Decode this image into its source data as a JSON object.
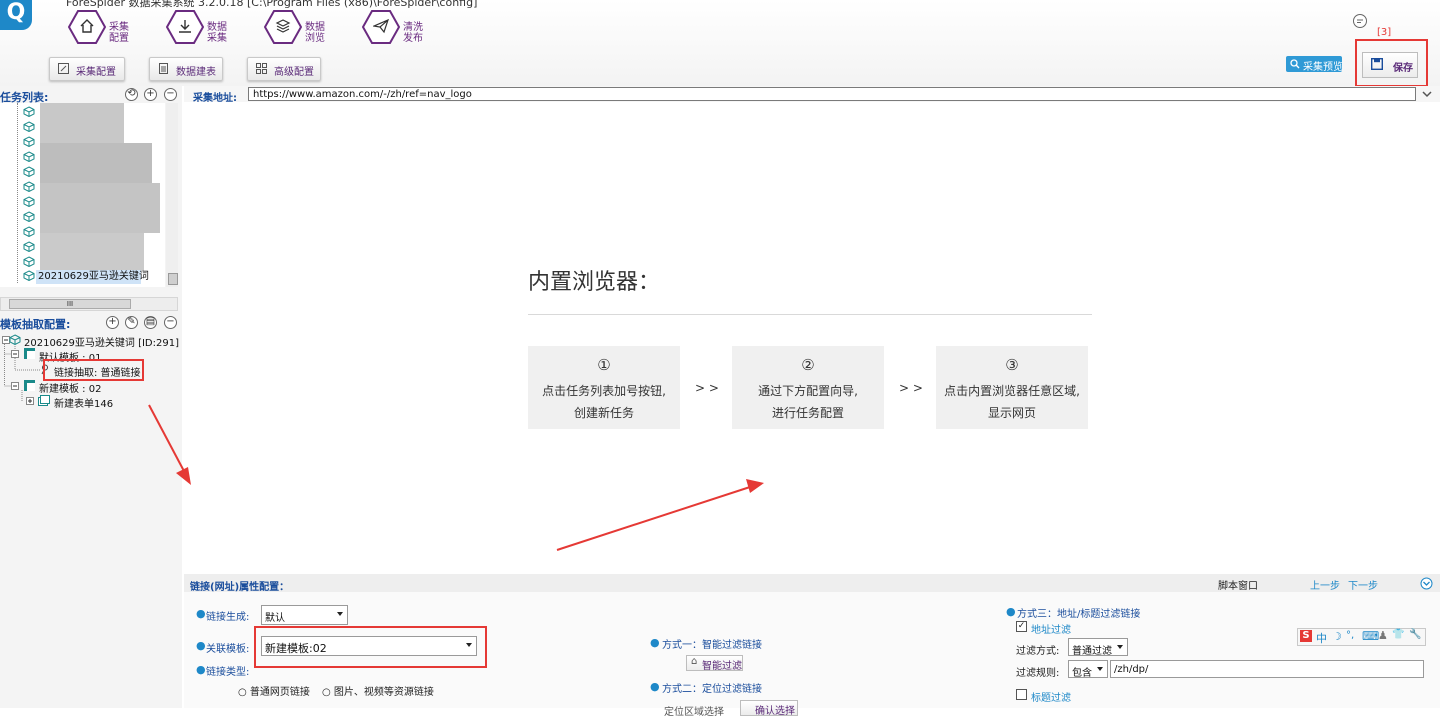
{
  "app": {
    "title": "ForeSpider 数据采集系统 3.2.0.18 [C:\\Program Files (x86)\\ForeSpider\\config]",
    "logo_text": "Q",
    "annotation": "[3]"
  },
  "nav": [
    {
      "label_top": "采集",
      "label_bottom": "配置",
      "icon": "home-icon"
    },
    {
      "label_top": "数据",
      "label_bottom": "采集",
      "icon": "download-icon"
    },
    {
      "label_top": "数据",
      "label_bottom": "浏览",
      "icon": "layers-icon"
    },
    {
      "label_top": "清洗",
      "label_bottom": "发布",
      "icon": "send-icon"
    }
  ],
  "tabs": [
    {
      "label": "采集配置",
      "icon": "edit-icon"
    },
    {
      "label": "数据建表",
      "icon": "document-icon"
    },
    {
      "label": "高级配置",
      "icon": "grid-icon"
    }
  ],
  "toolbar": {
    "preview_label": "采集预览",
    "save_label": "保存"
  },
  "task_list": {
    "label": "任务列表:",
    "buttons": [
      "⟲",
      "+",
      "−"
    ],
    "selected_item": "20210629亚马逊关键词"
  },
  "scroll": {
    "hscroll_grip": "III"
  },
  "template_config": {
    "label": "模板抽取配置:",
    "buttons": [
      "+",
      "✎",
      "▤",
      "−"
    ],
    "root": "20210629亚马逊关键词 [ID:291]",
    "default_template": "默认模板 : 01",
    "link_extract": "链接抽取: 普通链接",
    "new_template": "新建模板 : 02",
    "new_form": "新建表单146"
  },
  "url_bar": {
    "label": "采集地址:",
    "value": "https://www.amazon.com/-/zh/ref=nav_logo"
  },
  "browser": {
    "title": "内置浏览器：",
    "steps": [
      {
        "num": "①",
        "line1": "点击任务列表加号按钮,",
        "line2": "创建新任务"
      },
      {
        "num": "②",
        "line1": "通过下方配置向导,",
        "line2": "进行任务配置"
      },
      {
        "num": "③",
        "line1": "点击内置浏览器任意区域,",
        "line2": "显示网页"
      }
    ],
    "arrow": "> >"
  },
  "link_config": {
    "title": "链接(网址)属性配置：",
    "script_window": "脚本窗口",
    "prev": "上一步",
    "next": "下一步",
    "link_gen_label": "链接生成:",
    "link_gen_value": "默认",
    "template_label": "关联模板:",
    "template_value": "新建模板:02",
    "link_type_label": "链接类型:",
    "link_type_normal": "普通网页链接",
    "link_type_resource": "图片、视频等资源链接",
    "method1": "方式一：智能过滤链接",
    "smart_filter_btn": "智能过滤",
    "method2": "方式二：定位过滤链接",
    "method2_sub": "定位区域选择",
    "method2_btn": "确认选择",
    "method3": "方式三：地址/标题过滤链接",
    "addr_filter": "地址过滤",
    "filter_mode_label": "过滤方式:",
    "filter_mode_value": "普通过滤",
    "filter_rule_label": "过滤规则:",
    "filter_rule_op": "包含",
    "filter_rule_value": "/zh/dp/",
    "title_filter": "标题过滤"
  },
  "ime": {
    "items": [
      "S",
      "中",
      "☽",
      "°,",
      "⌨",
      "♟",
      "👕",
      "🔧"
    ]
  },
  "colors": {
    "accent": "#6a2b80",
    "link": "#1e88c8",
    "annotation": "#e53935"
  }
}
